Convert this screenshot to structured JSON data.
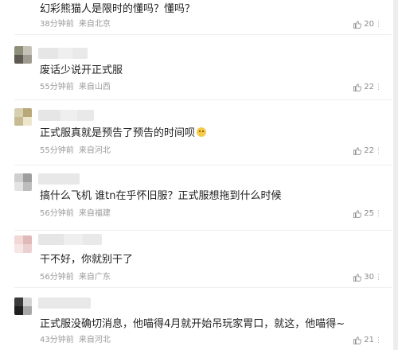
{
  "comments": [
    {
      "text": "幻彩熊猫人是限时的懂吗？懂吗？",
      "time": "38分钟前",
      "location": "来自北京",
      "likes": "20"
    },
    {
      "text": "废话少说开正式服",
      "time": "55分钟前",
      "location": "来自山西",
      "likes": "22"
    },
    {
      "text": "正式服真就是预告了预告的时间呗",
      "time": "55分钟前",
      "location": "来自河北",
      "likes": "22"
    },
    {
      "text": "搞什么飞机 谁tn在乎怀旧服？正式服想拖到什么时候",
      "time": "56分钟前",
      "location": "来自福建",
      "likes": "25"
    },
    {
      "text": "干不好，你就别干了",
      "time": "56分钟前",
      "location": "来自广东",
      "likes": "30"
    },
    {
      "text": "正式服没确切消息，他喵得4月就开始吊玩家胃口，就这，他喵得~",
      "time": "43分钟前",
      "location": "来自河北",
      "likes": "21"
    }
  ],
  "icons": {
    "like": "thumbs-up-icon",
    "more": "more-icon",
    "emoji": "smile-emoji-icon"
  }
}
